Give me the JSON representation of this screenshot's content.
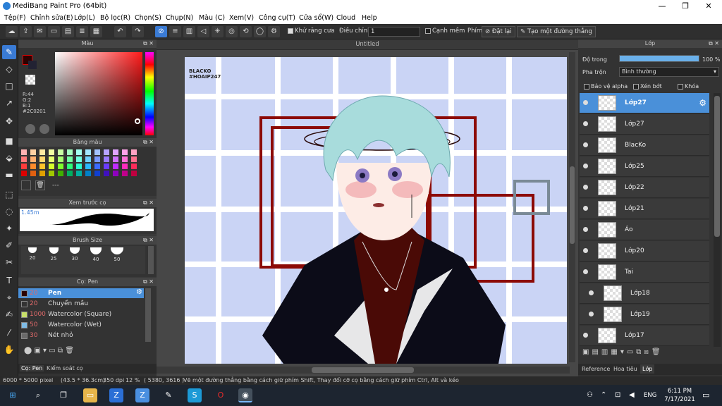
{
  "window": {
    "title": "MediBang Paint Pro (64bit)",
    "minimize": "—",
    "maximize": "❐",
    "close": "✕"
  },
  "menu": [
    "Tệp(F)",
    "Chỉnh sửa(E)",
    "Lớp(L)",
    "Bộ lọc(R)",
    "Chọn(S)",
    "Chụp(N)",
    "Màu (C)",
    "Xem(V)",
    "Công cụ(T)",
    "Cửa sổ(W)",
    "Cloud",
    "Help"
  ],
  "toolbar": {
    "antialias_label": "Khử răng cưa",
    "adjust_label": "Điều chỉnh",
    "adjust_value": "1",
    "canh_mem_label": "Cạnh mềm",
    "phim_label": "Phím",
    "reset_label": "Đặt lại",
    "straight_line_label": "Tạo một đường thẳng"
  },
  "color_panel": {
    "title": "Màu",
    "r": "R:44",
    "g": "G:2",
    "b": "B:1",
    "hex": "#2C0201",
    "current_color": "#2c0201"
  },
  "swatch_panel": {
    "title": "Bảng màu",
    "name": "---"
  },
  "preview_panel": {
    "title": "Xem trước cọ",
    "size": "1.45m"
  },
  "brush_size_panel": {
    "title": "Brush Size",
    "sizes": [
      "20",
      "25",
      "30",
      "40",
      "50"
    ]
  },
  "brush_panel": {
    "title": "Cọ: Pen",
    "items": [
      {
        "size": "20",
        "name": "Pen",
        "color": "#2c0201"
      },
      {
        "size": "20",
        "name": "Chuyển mầu",
        "color": "#333333"
      },
      {
        "size": "1000",
        "name": "Watercolor (Square)",
        "color": "#c8e06a"
      },
      {
        "size": "50",
        "name": "Watercolor (Wet)",
        "color": "#7fbce6"
      },
      {
        "size": "30",
        "name": "Nét nhỏ",
        "color": "#6a6a6a"
      }
    ],
    "tab1": "Cọ: Pen",
    "tab2": "Kiểm soát cọ"
  },
  "canvas": {
    "doc_title": "Untitled",
    "watermark_line1": "BLACKO",
    "watermark_line2": "#HOAIP247"
  },
  "layers_panel": {
    "title": "Lớp",
    "opacity_label": "Độ trong",
    "opacity_value": "100 %",
    "opacity_fraction": 1.0,
    "blend_label": "Pha trộn",
    "blend_value": "Bình thường",
    "protect_alpha": "Bảo vệ alpha",
    "clip": "Xén bớt",
    "lock": "Khóa",
    "layers": [
      {
        "name": "Lớp27",
        "selected": true,
        "indent": false
      },
      {
        "name": "Lớp27",
        "selected": false,
        "indent": false
      },
      {
        "name": "BlacKo",
        "selected": false,
        "indent": false
      },
      {
        "name": "Lớp25",
        "selected": false,
        "indent": false
      },
      {
        "name": "Lớp22",
        "selected": false,
        "indent": false
      },
      {
        "name": "Lớp21",
        "selected": false,
        "indent": false
      },
      {
        "name": "Áo",
        "selected": false,
        "indent": false
      },
      {
        "name": "Lớp20",
        "selected": false,
        "indent": false
      },
      {
        "name": "Tai",
        "selected": false,
        "indent": false
      },
      {
        "name": "Lớp18",
        "selected": false,
        "indent": true
      },
      {
        "name": "Lớp19",
        "selected": false,
        "indent": true
      },
      {
        "name": "Lớp17",
        "selected": false,
        "indent": false
      }
    ],
    "tabs": [
      "Reference",
      "Hoa tiêu",
      "Lớp"
    ]
  },
  "status": {
    "size": "6000 * 5000 pixel",
    "cm": "(43.5 * 36.3cm)",
    "dpi": "350 dpi",
    "zoom": "12 %",
    "coords": "( 5380, 3616 )",
    "hint": "Vẽ một đường thẳng bằng cách giữ phím Shift, Thay đổi cỡ cọ bằng cách giữ phím Ctrl, Alt và kéo"
  },
  "taskbar": {
    "time": "6:11 PM",
    "date": "7/17/2021",
    "lang": "ENG"
  }
}
